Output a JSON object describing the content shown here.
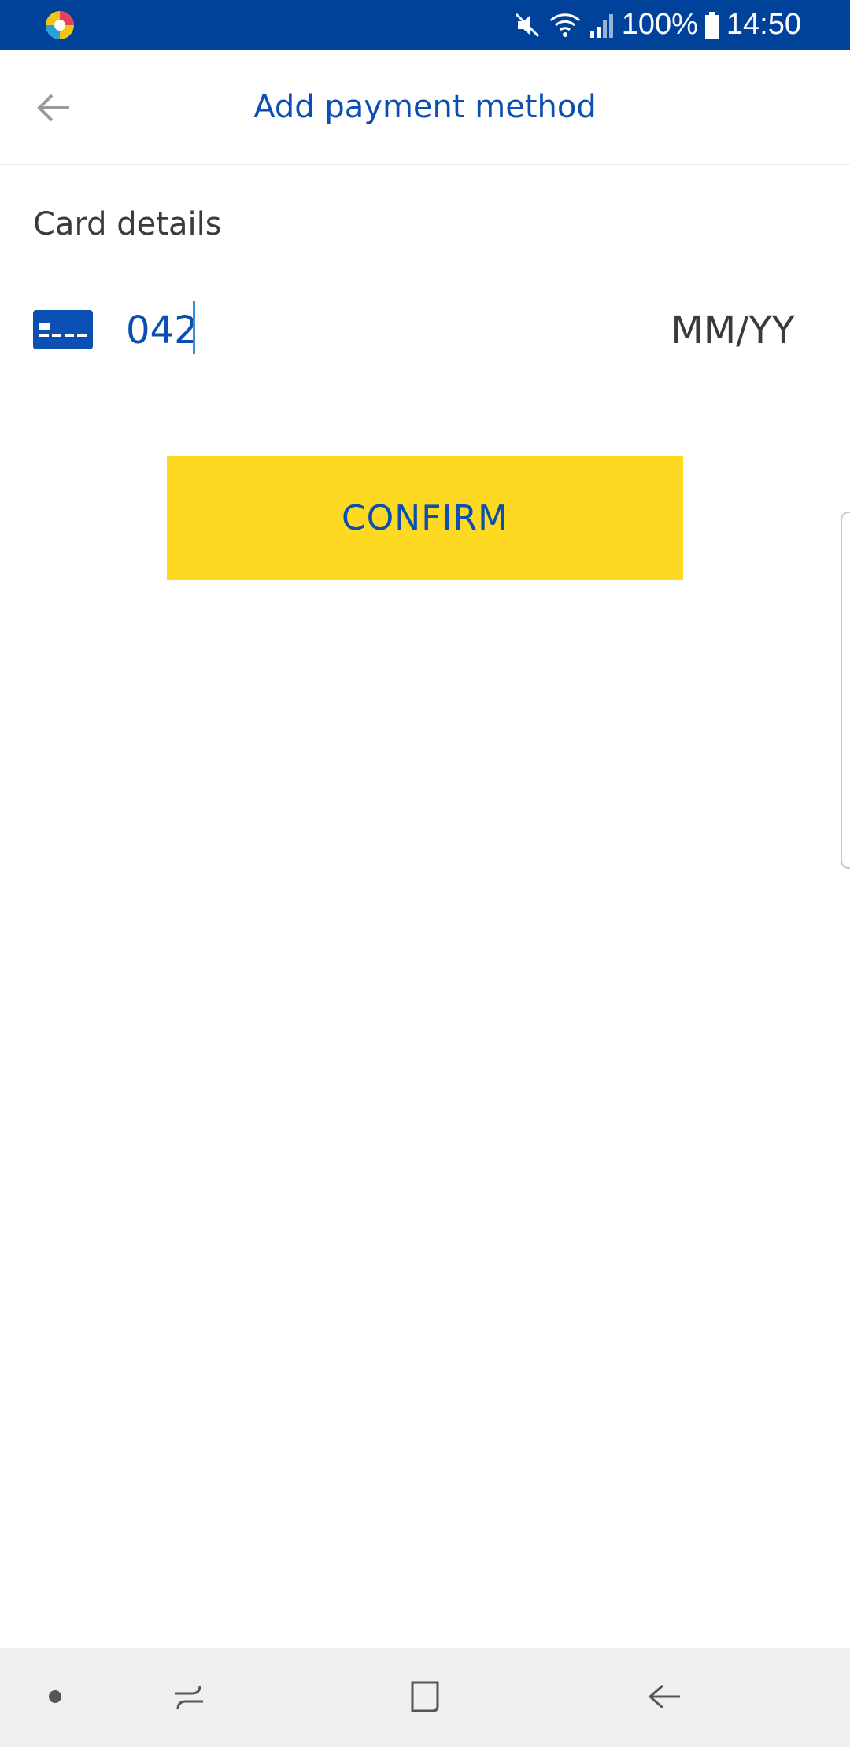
{
  "status_bar": {
    "battery_text": "100%",
    "time": "14:50",
    "icons": [
      "app-logo-icon",
      "mute-icon",
      "wifi-icon",
      "signal-icon",
      "battery-icon"
    ]
  },
  "app_bar": {
    "title": "Add payment method",
    "back_icon": "arrow-left-icon"
  },
  "form": {
    "section_label": "Card details",
    "card_icon": "credit-card-icon",
    "card_number_value": "042",
    "expiry_placeholder": "MM/YY"
  },
  "actions": {
    "confirm_label": "CONFIRM"
  },
  "nav_bar": {
    "icons": [
      "nav-dot-icon",
      "recent-apps-icon",
      "home-icon",
      "back-icon"
    ]
  },
  "colors": {
    "status_bar": "#004199",
    "accent_blue": "#0b4fb3",
    "confirm_yellow": "#fdd922",
    "nav_bar": "#efefef"
  }
}
